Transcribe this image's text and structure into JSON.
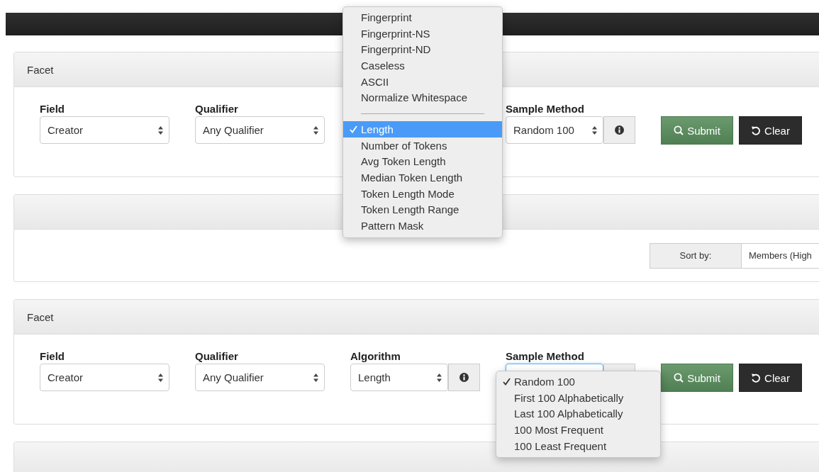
{
  "panels": [
    {
      "title": "Facet",
      "fields": [
        {
          "label": "Field",
          "value": "Creator"
        },
        {
          "label": "Qualifier",
          "value": "Any Qualifier"
        },
        {
          "menu": [
            {
              "kind": "option",
              "label": "Fingerprint",
              "selected": false
            },
            {
              "kind": "option",
              "label": "Fingerprint-NS",
              "selected": false
            },
            {
              "kind": "option",
              "label": "Fingerprint-ND",
              "selected": false
            },
            {
              "kind": "option",
              "label": "Caseless",
              "selected": false
            },
            {
              "kind": "option",
              "label": "ASCII",
              "selected": false
            },
            {
              "kind": "option",
              "label": "Normalize Whitespace",
              "selected": false
            },
            {
              "kind": "separator"
            },
            {
              "kind": "option",
              "label": "Length",
              "selected": true
            },
            {
              "kind": "option",
              "label": "Number of Tokens",
              "selected": false
            },
            {
              "kind": "option",
              "label": "Avg Token Length",
              "selected": false
            },
            {
              "kind": "option",
              "label": "Median Token Length",
              "selected": false
            },
            {
              "kind": "option",
              "label": "Token Length Mode",
              "selected": false
            },
            {
              "kind": "option",
              "label": "Token Length Range",
              "selected": false
            },
            {
              "kind": "option",
              "label": "Pattern Mask",
              "selected": false
            }
          ]
        },
        {
          "label": "Sample Method",
          "value": "Random 100",
          "info_button": true,
          "info_icon": true
        }
      ],
      "buttons": [
        {
          "kind": "submit",
          "label": "Submit"
        },
        {
          "kind": "clear",
          "label": "Clear"
        }
      ]
    },
    {
      "sort": {
        "label": "Sort by:",
        "value": "Members (High"
      }
    },
    {
      "title": "Facet",
      "fields": [
        {
          "label": "Field",
          "value": "Creator"
        },
        {
          "label": "Qualifier",
          "value": "Any Qualifier"
        },
        {
          "label": "Algorithm",
          "value": "Length",
          "info_button": true,
          "info_icon": true
        },
        {
          "label": "Sample Method",
          "focused": true,
          "info_button": true,
          "info_icon": false,
          "menu": [
            {
              "kind": "option",
              "label": "Random 100",
              "selected": true
            },
            {
              "kind": "option",
              "label": "First 100 Alphabetically",
              "selected": false
            },
            {
              "kind": "option",
              "label": "Last 100 Alphabetically",
              "selected": false
            },
            {
              "kind": "option",
              "label": "100 Most Frequent",
              "selected": false
            },
            {
              "kind": "option",
              "label": "100 Least Frequent",
              "selected": false
            }
          ]
        }
      ],
      "buttons": [
        {
          "kind": "submit",
          "label": "Submit"
        },
        {
          "kind": "clear",
          "label": "Clear"
        }
      ]
    }
  ]
}
